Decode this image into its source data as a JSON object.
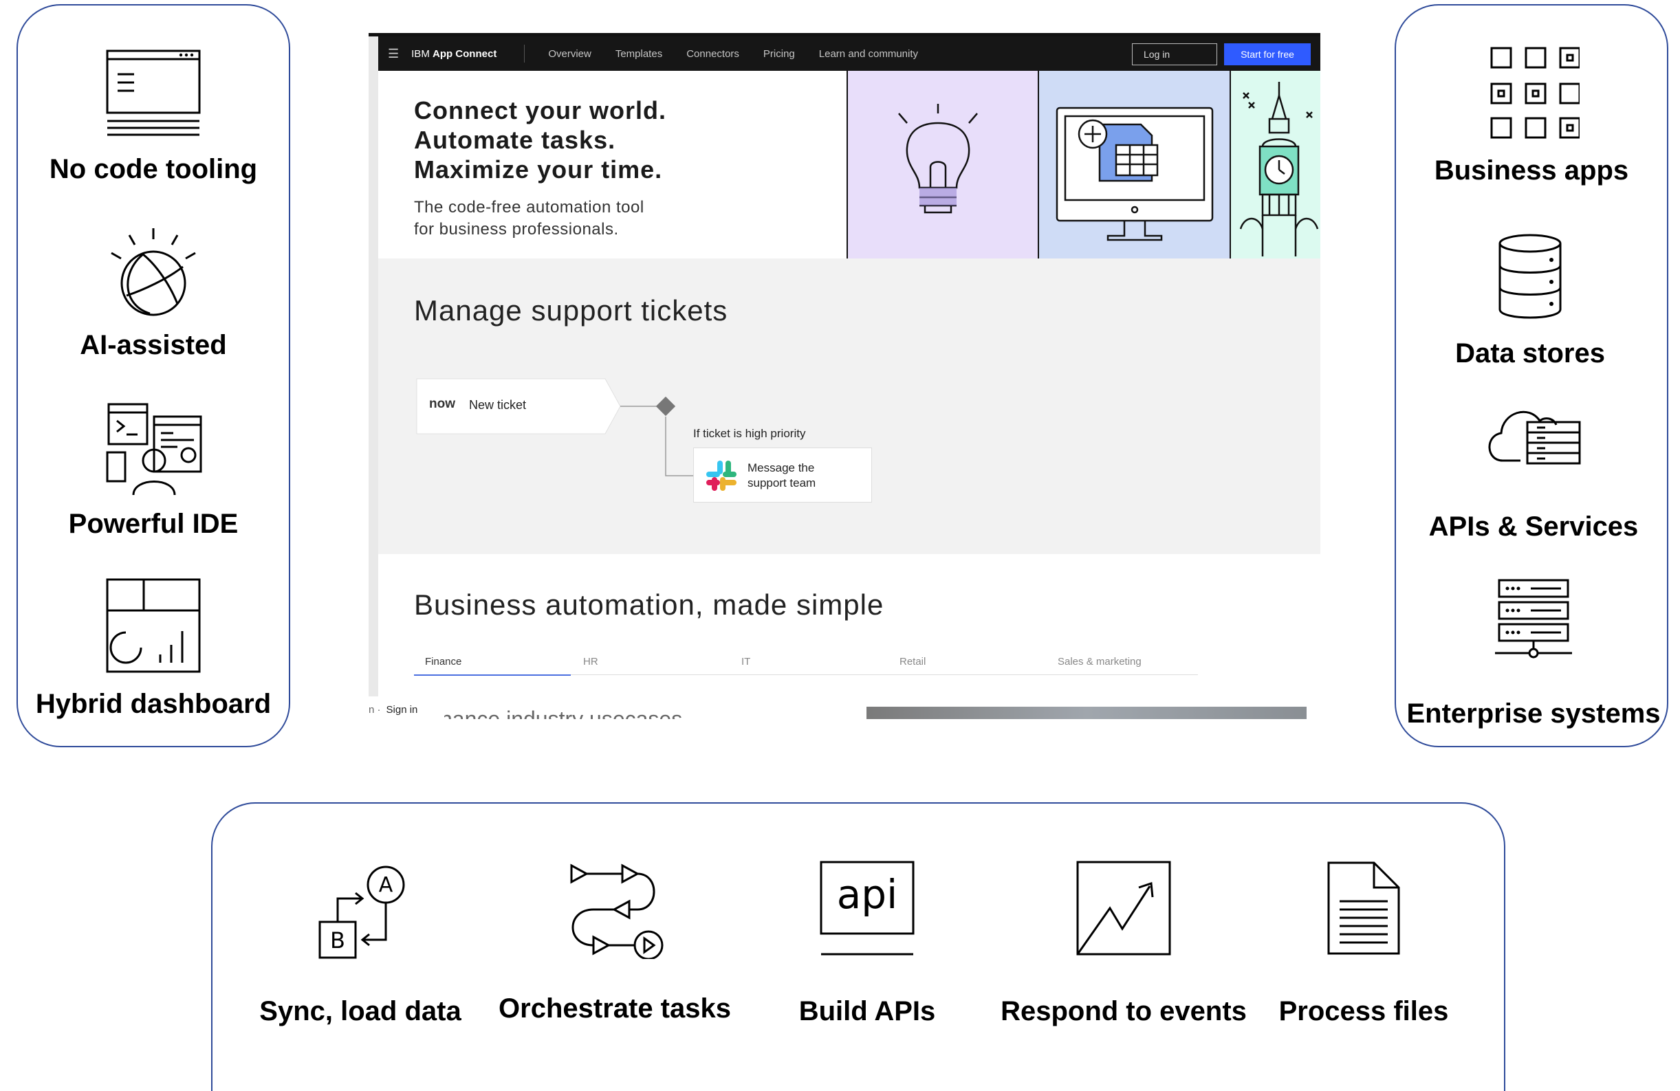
{
  "left_features": [
    {
      "label": "No code tooling",
      "icon": "browser-window-icon"
    },
    {
      "label": "AI-assisted",
      "icon": "lightbulb-globe-icon"
    },
    {
      "label": "Powerful IDE",
      "icon": "developer-ide-icon"
    },
    {
      "label": "Hybrid dashboard",
      "icon": "dashboard-icon"
    }
  ],
  "right_features": [
    {
      "label": "Business apps",
      "icon": "app-grid-icon"
    },
    {
      "label": "Data stores",
      "icon": "database-icon"
    },
    {
      "label": "APIs & Services",
      "icon": "cloud-services-icon"
    },
    {
      "label": "Enterprise systems",
      "icon": "server-rack-icon"
    }
  ],
  "bottom_features": [
    {
      "label": "Sync, load data",
      "icon": "sync-ab-icon"
    },
    {
      "label": "Orchestrate tasks",
      "icon": "orchestrate-flow-icon"
    },
    {
      "label": "Build APIs",
      "icon": "api-icon",
      "icon_text": "api"
    },
    {
      "label": "Respond to events",
      "icon": "trend-chart-icon"
    },
    {
      "label": "Process files",
      "icon": "document-icon"
    }
  ],
  "screenshot": {
    "nav": {
      "brand_prefix": "IBM",
      "brand_name": "App Connect",
      "links": [
        "Overview",
        "Templates",
        "Connectors",
        "Pricing",
        "Learn and community"
      ],
      "login": "Log in",
      "start": "Start for free"
    },
    "hero": {
      "headline_lines": [
        "Connect your world.",
        "Automate tasks.",
        "Maximize your time."
      ],
      "subtitle_lines": [
        "The code-free automation tool",
        "for business professionals."
      ]
    },
    "tickets": {
      "title": "Manage support tickets",
      "now_logo": "now",
      "new_ticket": "New ticket",
      "condition": "If ticket is high priority",
      "message_lines": [
        "Message the",
        "support team"
      ]
    },
    "automation": {
      "title": "Business automation, made simple",
      "tabs": [
        "Finance",
        "HR",
        "IT",
        "Retail",
        "Sales & marketing"
      ],
      "subtitle": "nance industry usecases",
      "signin": "Sign in",
      "signin_prefix": "n ·"
    }
  },
  "colors": {
    "panel_border": "#2f4b9a",
    "start_button": "#2f5bff",
    "nav_bg": "#161616"
  }
}
